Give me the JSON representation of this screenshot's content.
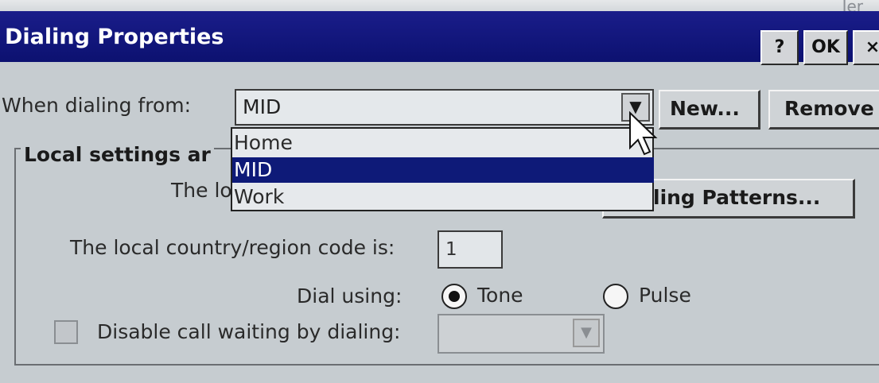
{
  "window": {
    "title": "Dialing Properties",
    "help_label": "?",
    "ok_label": "OK",
    "close_label": "×",
    "background_cut_text": "Jer"
  },
  "dialing_from": {
    "label": "When dialing from:",
    "value": "MID",
    "options": [
      "Home",
      "MID",
      "Work"
    ],
    "selected_index": 1
  },
  "buttons": {
    "new_label": "New...",
    "remove_label": "Remove",
    "patterns_label": "ling Patterns..."
  },
  "local_settings": {
    "group_title": "Local settings ar",
    "area_code_label_partial": "The lo",
    "country_label": "The local country/region code is:",
    "country_code": "1",
    "dial_using_label": "Dial using:",
    "tone_label": "Tone",
    "pulse_label": "Pulse",
    "dial_mode": "tone",
    "call_waiting_label": "Disable call waiting by dialing:",
    "call_waiting_checked": false
  },
  "icons": {
    "dropdown_arrow": "chevron-down-icon",
    "cursor": "mouse-pointer-icon"
  },
  "colors": {
    "titlebar": "#0c1170",
    "selection": "#0e1a78",
    "window_bg": "#c6ccd0"
  }
}
